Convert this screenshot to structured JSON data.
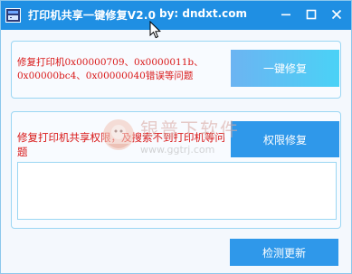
{
  "titlebar": {
    "title": "打印机共享一键修复V2.0",
    "by": "by:  dndxt.com",
    "controls": {
      "minimize": "—",
      "maximize": "☐",
      "close": "✕"
    }
  },
  "panel1": {
    "description": "修复打印机0x00000709、0x0000011b、0x00000bc4、0x00000040错误等问题",
    "button_label": "一键修复"
  },
  "panel2": {
    "description": "修复打印机共享权限，及搜索不到打印机等问题",
    "button_label": "权限修复",
    "log_value": ""
  },
  "footer": {
    "update_button_label": "检测更新"
  },
  "watermark": {
    "brand": "银普下软件",
    "url": "www.ggtrj.com"
  },
  "colors": {
    "titlebar": "#1f8fe3",
    "accent_button": "#2f98ea",
    "gradient_start": "#6cb4f2",
    "gradient_end": "#4ad2f6",
    "error_text": "#d91717",
    "panel_border": "#9ad6f3"
  },
  "icons": {
    "app": "printer-app-icon",
    "cursor": "mouse-pointer-icon",
    "watermark": "watermark-logo"
  }
}
